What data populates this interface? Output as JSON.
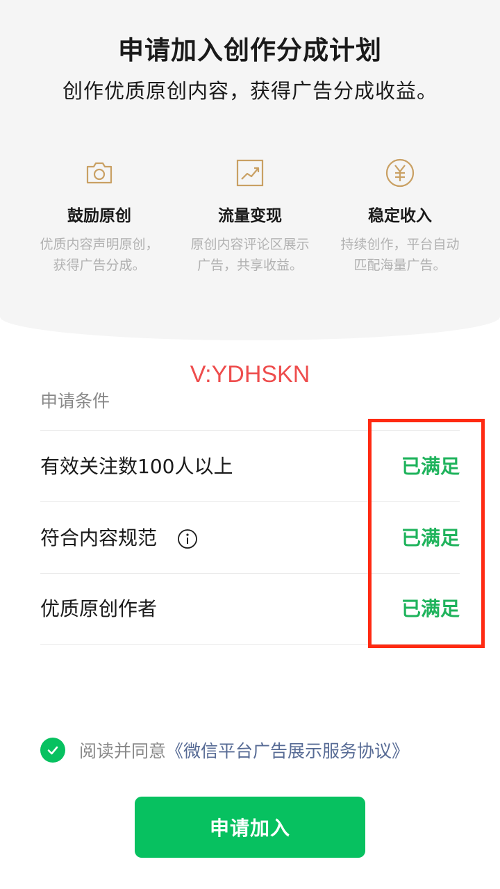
{
  "header": {
    "title": "申请加入创作分成计划",
    "subtitle": "创作优质原创内容，获得广告分成收益。"
  },
  "features": [
    {
      "icon": "camera-icon",
      "title": "鼓励原创",
      "desc_line1": "优质内容声明原创，",
      "desc_line2": "获得广告分成。"
    },
    {
      "icon": "trend-chart-icon",
      "title": "流量变现",
      "desc_line1": "原创内容评论区展示",
      "desc_line2": "广告，共享收益。"
    },
    {
      "icon": "yuan-icon",
      "title": "稳定收入",
      "desc_line1": "持续创作，平台自动",
      "desc_line2": "匹配海量广告。"
    }
  ],
  "watermark": "V:YDHSKN",
  "conditions": {
    "section_label": "申请条件",
    "items": [
      {
        "label": "有效关注数100人以上",
        "status": "已满足"
      },
      {
        "label": "符合内容规范",
        "status": "已满足",
        "has_info_icon": true
      },
      {
        "label": "优质原创作者",
        "status": "已满足"
      }
    ]
  },
  "agreement": {
    "prefix": "阅读并同意",
    "link": "《微信平台广告展示服务协议》",
    "checked": true
  },
  "apply_button": {
    "label": "申请加入"
  },
  "colors": {
    "accent_green": "#07c160",
    "status_green": "#1fb35c",
    "link_blue": "#576b95",
    "icon_gold": "#c9a063",
    "highlight_red": "#ff2a12",
    "watermark_red": "#ee4d4d"
  }
}
